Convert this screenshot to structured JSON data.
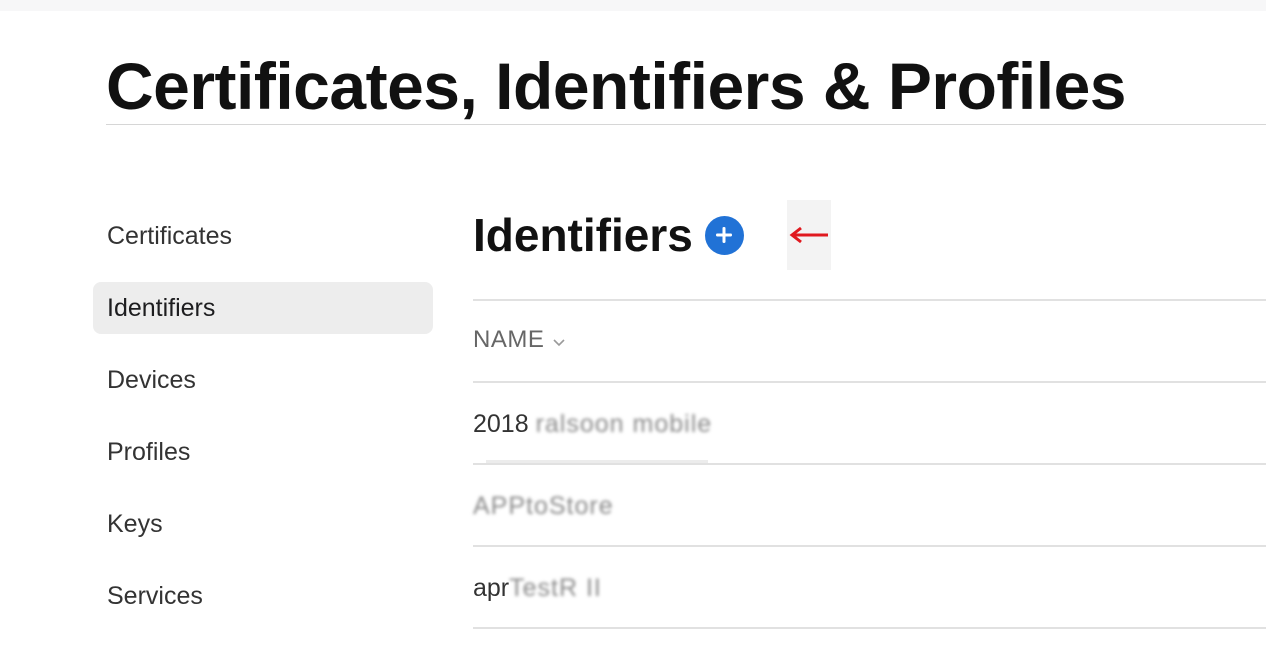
{
  "page": {
    "title": "Certificates, Identifiers & Profiles"
  },
  "sidebar": {
    "items": [
      {
        "label": "Certificates",
        "active": false
      },
      {
        "label": "Identifiers",
        "active": true
      },
      {
        "label": "Devices",
        "active": false
      },
      {
        "label": "Profiles",
        "active": false
      },
      {
        "label": "Keys",
        "active": false
      },
      {
        "label": "Services",
        "active": false
      }
    ]
  },
  "main": {
    "section_title": "Identifiers",
    "add_button_icon": "plus-circle-icon",
    "annotation_icon": "red-left-arrow-icon",
    "column_header": "NAME",
    "sort_icon": "chevron-down-icon",
    "rows": [
      {
        "visible": "2018",
        "obscured": "ralsoon mobile"
      },
      {
        "visible": "",
        "obscured": "APPtoStore"
      },
      {
        "visible": "apr",
        "obscured": "TestR II"
      }
    ]
  },
  "colors": {
    "accent": "#2172d6",
    "annotation": "#e0191f",
    "active_bg": "#ededed",
    "divider": "#e1e1e1"
  }
}
